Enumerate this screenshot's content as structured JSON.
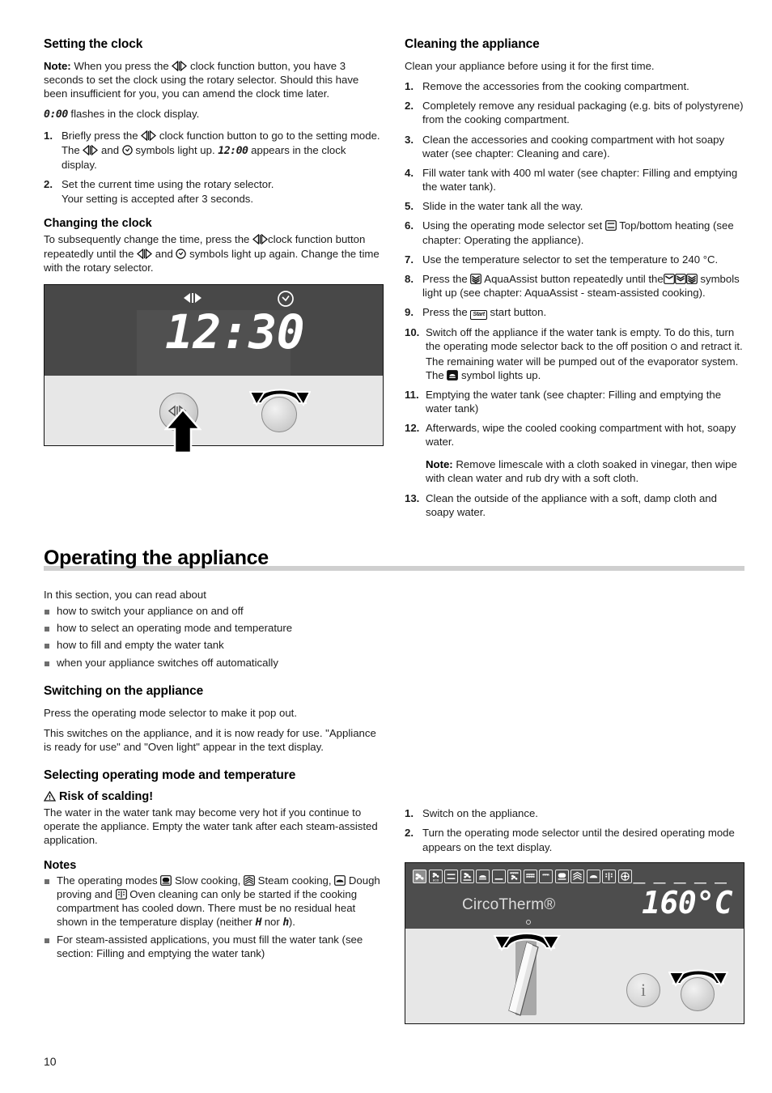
{
  "page": {
    "number": "10"
  },
  "left_column": {
    "setting_clock": {
      "heading": "Setting the clock",
      "note_label": "Note:",
      "note_text_a": " When you press the ",
      "note_text_b": " clock function button, you have 3 seconds to set the clock using the rotary selector. Should this have been insufficient for you, you can amend the clock time later.",
      "flash_value": "0:00",
      "flash_text": " flashes in the clock display.",
      "steps": [
        {
          "num": "1.",
          "text_a": "Briefly press the ",
          "text_b": " clock function button to go to the setting mode.",
          "sub_a": "The ",
          "sub_b": " and ",
          "sub_c": " symbols light up. ",
          "sub_value": "12:00",
          "sub_d": " appears in the clock display."
        },
        {
          "num": "2.",
          "text_a": "Set the current time using the rotary selector.",
          "sub_a": "Your setting is accepted after 3 seconds."
        }
      ],
      "changing": {
        "heading": "Changing the clock",
        "text_a": "To subsequently change the time, press the ",
        "text_b": "clock function button repeatedly until the ",
        "text_c": " and ",
        "text_d": " symbols light up again. Change the time with the rotary selector."
      },
      "figure": {
        "display_time": "12:30",
        "symbol_arrows": "clock-function-arrows",
        "symbol_clock": "clock-symbol",
        "button_label": "clock-function-button",
        "rotary_label": "rotary-selector"
      }
    },
    "operating": {
      "heading": "Operating the appliance",
      "intro": "In this section, you can read about",
      "bullets": [
        "how to switch your appliance on and off",
        "how to select an operating mode and temperature",
        "how to fill and empty the water tank",
        "when your appliance switches off automatically"
      ],
      "switching_on": {
        "heading": "Switching on the appliance",
        "p1": "Press the operating mode selector to make it pop out.",
        "p2": "This switches on the appliance, and it is now ready for use. \"Appliance is ready for use\" and \"Oven light\" appear in the text display."
      },
      "selecting": {
        "heading": "Selecting operating mode and temperature",
        "warning": "Risk of scalding!",
        "warning_body": "The water in the water tank may become very hot if you continue to operate the appliance. Empty the water tank after each steam-assisted application.",
        "notes_heading": "Notes",
        "note_1_a": "The operating modes ",
        "note_1_b": " Slow cooking, ",
        "note_1_c": " Steam cooking, ",
        "note_1_d": " Dough proving and ",
        "note_1_e": " Oven cleaning can only be started if the cooking compartment has cooled down. There must be no residual heat shown in the temperature display (neither ",
        "note_1_h1": "H",
        "note_1_f": " nor ",
        "note_1_h2": "h",
        "note_1_g": ").",
        "note_2": "For steam-assisted applications, you must fill the water tank (see section: Filling and emptying the water tank)"
      }
    }
  },
  "right_column": {
    "cleaning": {
      "heading": "Cleaning the appliance",
      "intro": "Clean your appliance before using it for the first time.",
      "steps": [
        {
          "num": "1.",
          "text": "Remove the accessories from the cooking compartment."
        },
        {
          "num": "2.",
          "text": "Completely remove any residual packaging (e.g. bits of polystyrene) from the cooking compartment."
        },
        {
          "num": "3.",
          "text": "Clean the accessories and cooking compartment with hot soapy water (see chapter: Cleaning and care)."
        },
        {
          "num": "4.",
          "text": "Fill water tank with 400 ml water (see chapter: Filling and emptying the water tank)."
        },
        {
          "num": "5.",
          "text": "Slide in the water tank all the way."
        },
        {
          "num": "6.",
          "text_a": "Using the operating mode selector set ",
          "text_b": " Top/bottom heating (see chapter: Operating the appliance)."
        },
        {
          "num": "7.",
          "text": "Use the temperature selector to set the temperature to 240 °C."
        },
        {
          "num": "8.",
          "text_a": "Press the ",
          "text_b": " AquaAssist button repeatedly until the",
          "text_c": " symbols light up (see chapter: AquaAssist - steam-assisted cooking)."
        },
        {
          "num": "9.",
          "text_a": "Press the ",
          "start_label": "Start",
          "text_b": " start button."
        },
        {
          "num": "10.",
          "text_a": "Switch off the appliance if the water tank is empty. To do this, turn the operating mode selector back to the off position ",
          "off_symbol": "O",
          "text_b": " and retract it.",
          "sub_a": "The remaining water will be pumped out of the evaporator system. The ",
          "sub_b": " symbol lights up."
        },
        {
          "num": "11.",
          "text": "Emptying the water tank (see chapter: Filling and emptying the water tank)"
        },
        {
          "num": "12.",
          "text": "Afterwards, wipe the cooled cooking compartment with hot, soapy water."
        }
      ],
      "note_label": "Note:",
      "note_text": " Remove limescale with a cloth soaked in vinegar, then wipe with clean water and rub dry with a soft cloth.",
      "step_13": {
        "num": "13.",
        "text": "Clean the outside of the appliance with a soft, damp cloth and soapy water."
      }
    },
    "operating_steps": [
      {
        "num": "1.",
        "text": "Switch on the appliance."
      },
      {
        "num": "2.",
        "text": "Turn the operating mode selector until the desired operating mode appears on the text display."
      }
    ],
    "panel_figure": {
      "display_mode": "CircoTherm®",
      "display_temperature": "160°C",
      "dashes": "— — — — —",
      "info_button_label": "i",
      "mode_icons": [
        {
          "name": "circotherm-icon",
          "selected": true
        },
        {
          "name": "circotherm-eco-icon",
          "selected": false
        },
        {
          "name": "top-bottom-heating-icon",
          "selected": false
        },
        {
          "name": "circotherm-intensive-icon",
          "selected": false
        },
        {
          "name": "bottom-heating-icon",
          "selected": false
        },
        {
          "name": "base-heat-icon",
          "selected": false
        },
        {
          "name": "full-grill-circo-icon",
          "selected": false
        },
        {
          "name": "full-grill-icon",
          "selected": false
        },
        {
          "name": "half-grill-icon",
          "selected": false
        },
        {
          "name": "slow-cooking-icon",
          "selected": false
        },
        {
          "name": "steam-cooking-icon",
          "selected": false
        },
        {
          "name": "dough-proving-icon",
          "selected": false
        },
        {
          "name": "oven-cleaning-icon",
          "selected": false
        },
        {
          "name": "defrost-icon",
          "selected": false
        }
      ],
      "selector_label": "operating-mode-selector",
      "rotary_label": "rotary-selector"
    }
  }
}
